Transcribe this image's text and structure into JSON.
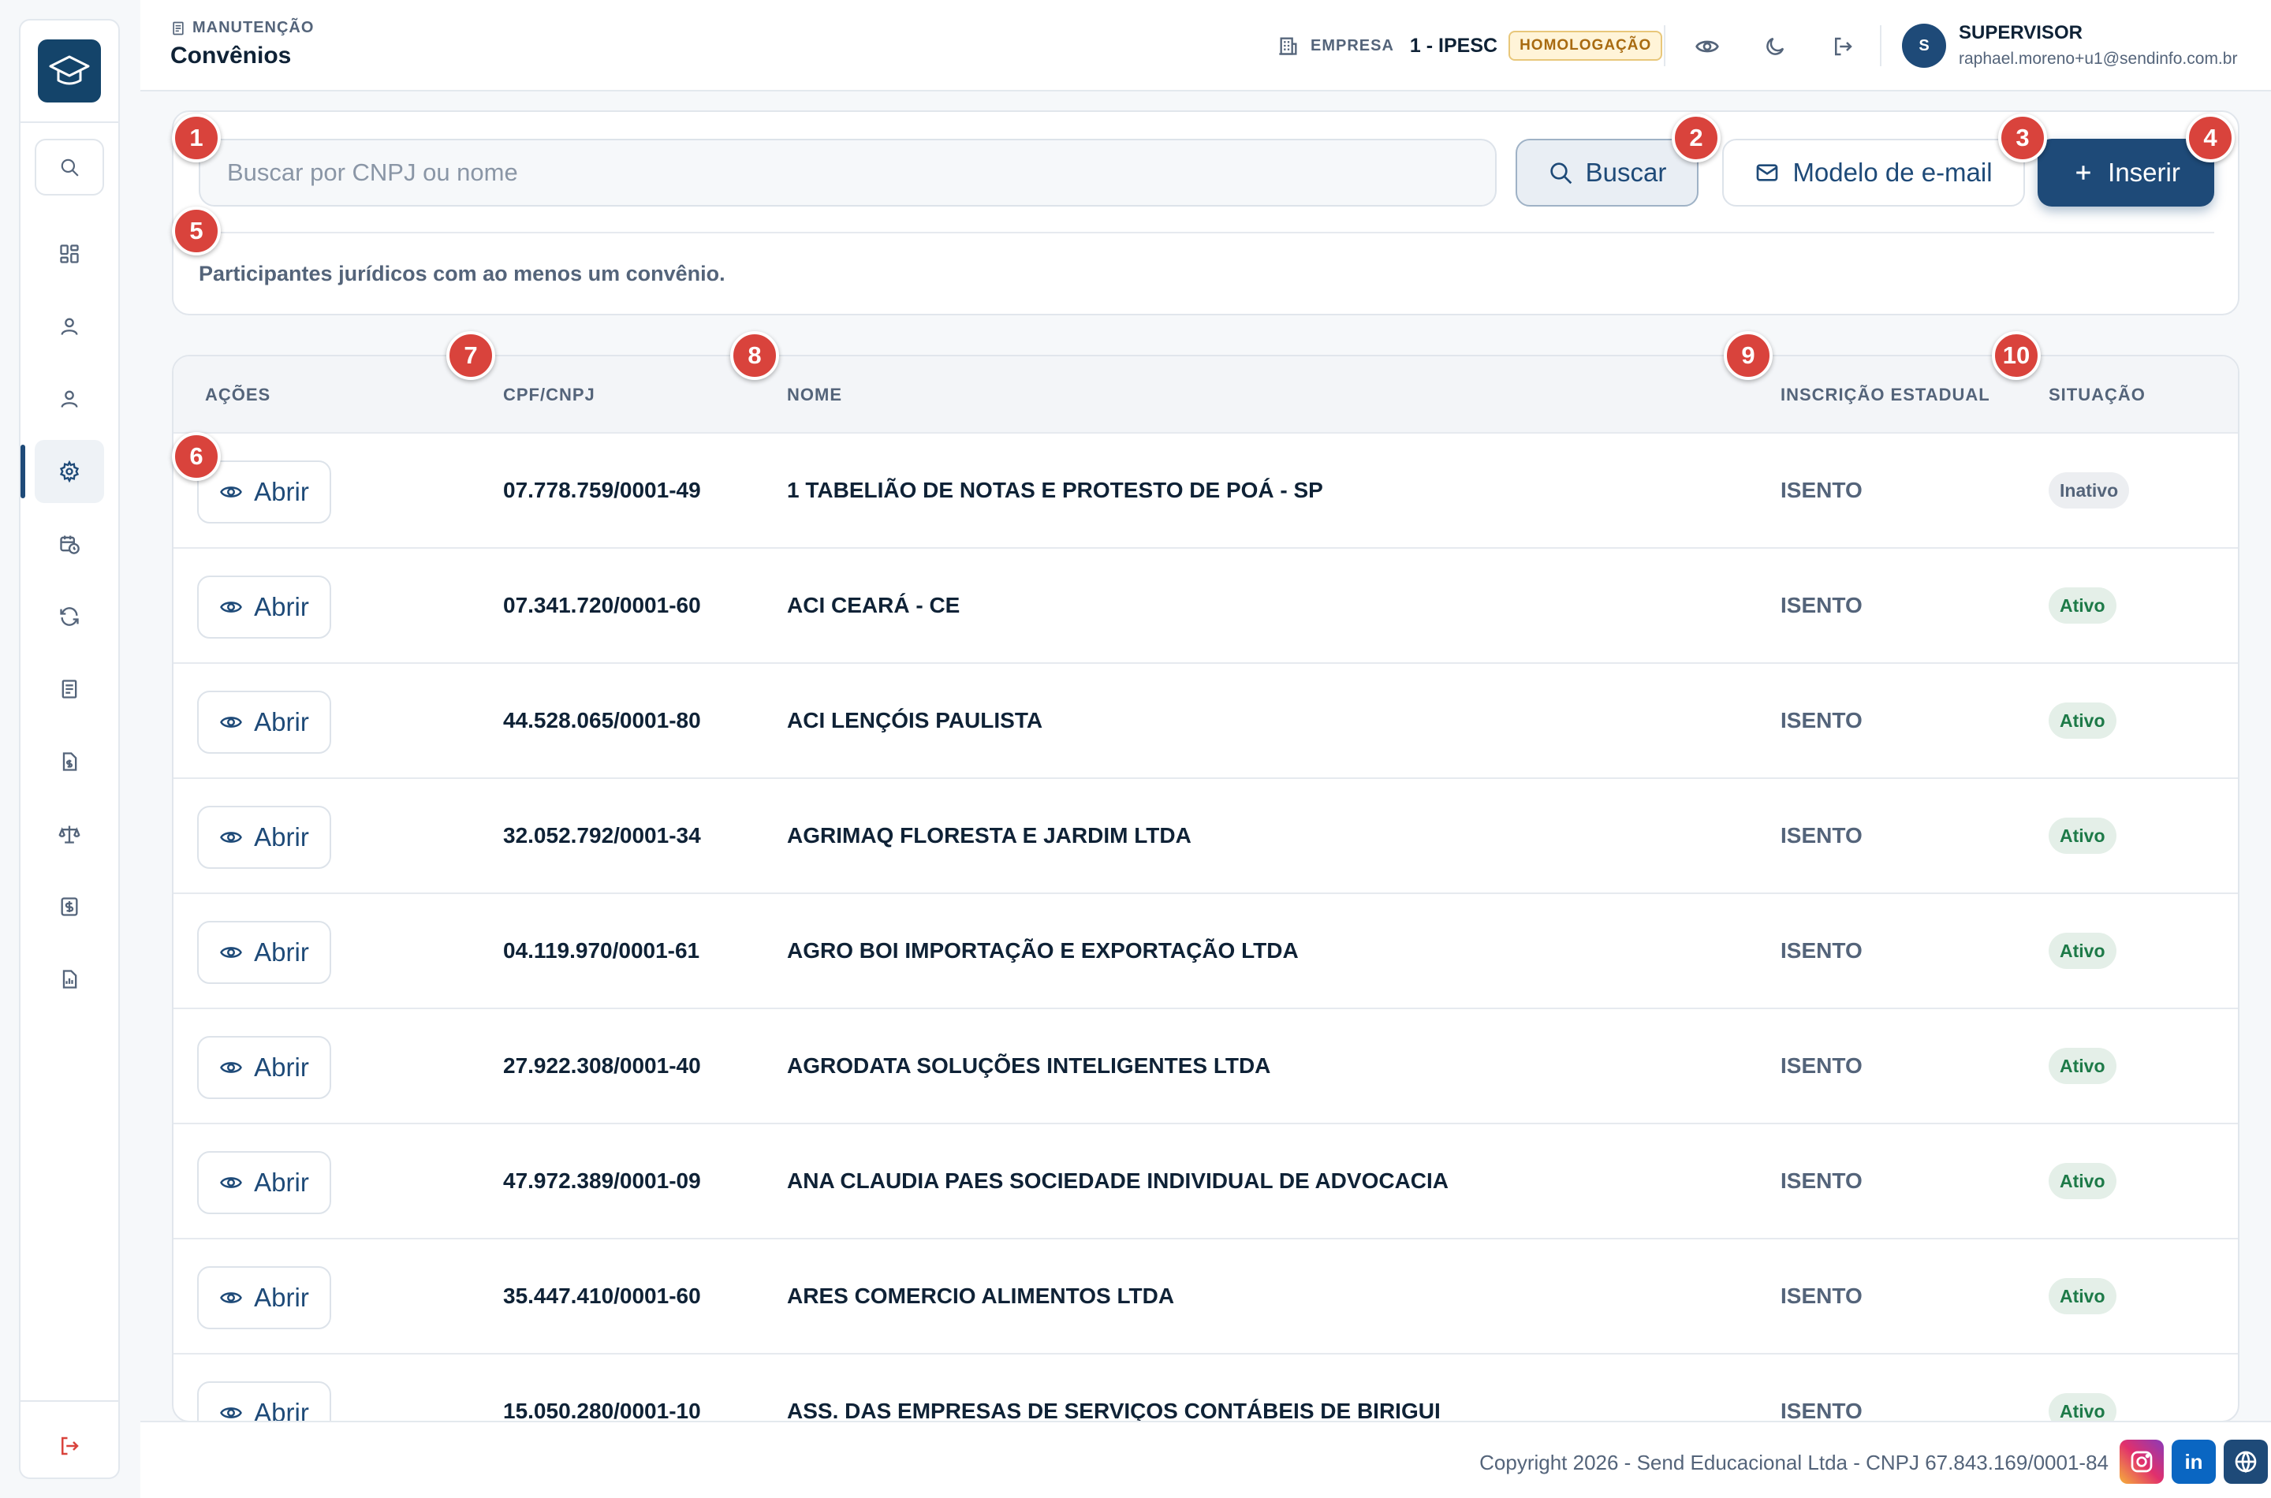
{
  "header": {
    "breadcrumb": "MANUTENÇÃO",
    "title": "Convênios",
    "company_label": "EMPRESA",
    "company_value": "1 - IPESC",
    "env_badge": "HOMOLOGAÇÃO",
    "user": {
      "initial": "S",
      "name": "SUPERVISOR",
      "email": "raphael.moreno+u1@sendinfo.com.br"
    },
    "icons": [
      "eye-icon",
      "moon-icon",
      "logout-icon"
    ]
  },
  "sidebar": {
    "items": [
      "dashboard-icon",
      "user-icon",
      "user-icon",
      "gear-icon",
      "calendar-clock-icon",
      "refresh-icon",
      "document-icon",
      "file-money-icon",
      "scale-icon",
      "dollar-icon",
      "report-icon"
    ],
    "active_index": 3
  },
  "search": {
    "placeholder": "Buscar por CNPJ ou nome",
    "value": "",
    "buscar_label": "Buscar",
    "modelo_label": "Modelo de e-mail",
    "inserir_label": "Inserir",
    "note": "Participantes jurídicos com ao menos um convênio."
  },
  "table": {
    "columns": {
      "acoes": "AÇÕES",
      "cnpj": "CPF/CNPJ",
      "nome": "NOME",
      "ie": "INSCRIÇÃO ESTADUAL",
      "situacao": "SITUAÇÃO"
    },
    "open_label": "Abrir",
    "rows": [
      {
        "cnpj": "07.778.759/0001-49",
        "nome": "1 TABELIÃO DE NOTAS E PROTESTO DE POÁ - SP",
        "ie": "ISENTO",
        "situacao": "Inativo"
      },
      {
        "cnpj": "07.341.720/0001-60",
        "nome": "ACI CEARÁ - CE",
        "ie": "ISENTO",
        "situacao": "Ativo"
      },
      {
        "cnpj": "44.528.065/0001-80",
        "nome": "ACI LENÇÓIS PAULISTA",
        "ie": "ISENTO",
        "situacao": "Ativo"
      },
      {
        "cnpj": "32.052.792/0001-34",
        "nome": "AGRIMAQ FLORESTA E JARDIM LTDA",
        "ie": "ISENTO",
        "situacao": "Ativo"
      },
      {
        "cnpj": "04.119.970/0001-61",
        "nome": "AGRO BOI IMPORTAÇÃO E EXPORTAÇÃO LTDA",
        "ie": "ISENTO",
        "situacao": "Ativo"
      },
      {
        "cnpj": "27.922.308/0001-40",
        "nome": "AGRODATA SOLUÇÕES INTELIGENTES LTDA",
        "ie": "ISENTO",
        "situacao": "Ativo"
      },
      {
        "cnpj": "47.972.389/0001-09",
        "nome": "ANA CLAUDIA PAES SOCIEDADE INDIVIDUAL DE ADVOCACIA",
        "ie": "ISENTO",
        "situacao": "Ativo"
      },
      {
        "cnpj": "35.447.410/0001-60",
        "nome": "ARES COMERCIO ALIMENTOS LTDA",
        "ie": "ISENTO",
        "situacao": "Ativo"
      },
      {
        "cnpj": "15.050.280/0001-10",
        "nome": "ASS. DAS EMPRESAS DE SERVIÇOS CONTÁBEIS DE BIRIGUI",
        "ie": "ISENTO",
        "situacao": "Ativo"
      }
    ]
  },
  "markers": [
    "1",
    "2",
    "3",
    "4",
    "5",
    "6",
    "7",
    "8",
    "9",
    "10"
  ],
  "footer": {
    "copyright": "Copyright 2026 - Send Educacional Ltda - CNPJ 67.843.169/0001-84",
    "social": [
      "instagram-icon",
      "linkedin-icon",
      "globe-icon"
    ],
    "linkedin_text": "in"
  },
  "colors": {
    "primary": "#1e4a78",
    "marker": "#d9433c",
    "active_bg": "#e4efe8",
    "active_text": "#1d7a48",
    "warning": "#a86a10"
  }
}
